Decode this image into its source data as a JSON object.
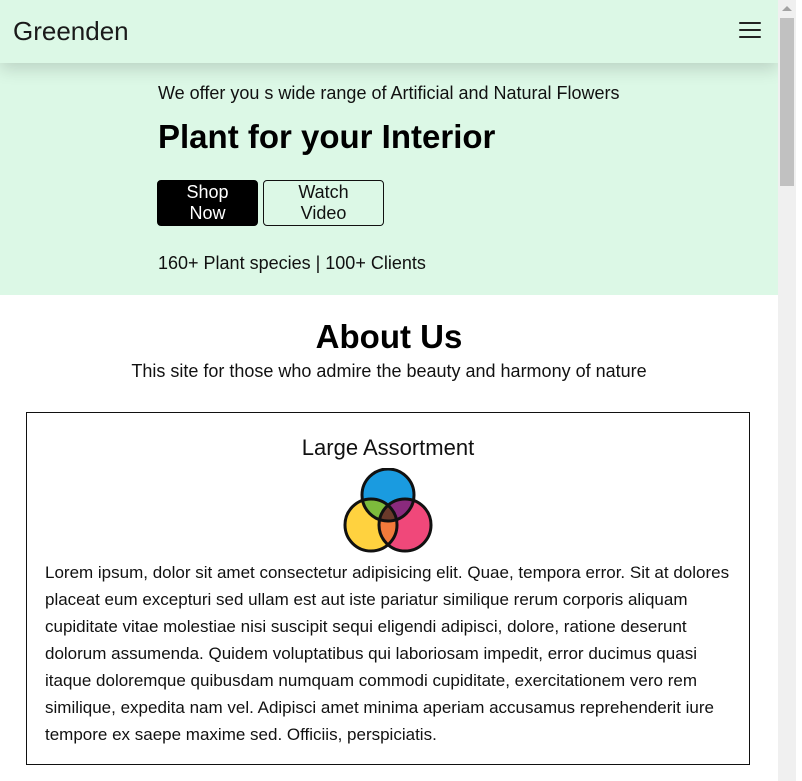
{
  "navbar": {
    "brand": "Greenden",
    "menu_icon": "hamburger-menu-icon"
  },
  "hero": {
    "subtitle": "We offer you s wide range of Artificial and Natural Flowers",
    "title": "Plant for your Interior",
    "shop_button": "Shop Now",
    "watch_button": "Watch Video",
    "stats": "160+ Plant species | 100+ Clients"
  },
  "about": {
    "title": "About Us",
    "subtitle": "This site for those who admire the beauty and harmony of nature",
    "card": {
      "title": "Large Assortment",
      "icon": "venn-circles-icon",
      "text": "Lorem ipsum, dolor sit amet consectetur adipisicing elit. Quae, tempora error. Sit at dolores placeat eum excepturi sed ullam est aut iste pariatur similique rerum corporis aliquam cupiditate vitae molestiae nisi suscipit sequi eligendi adipisci, dolore, ratione deserunt dolorum assumenda. Quidem voluptatibus qui laboriosam impedit, error ducimus quasi itaque doloremque quibusdam numquam commodi cupiditate, exercitationem vero rem similique, expedita nam vel. Adipisci amet minima aperiam accusamus reprehenderit iure tempore ex saepe maxime sed. Officiis, perspiciatis."
    }
  },
  "colors": {
    "hero_background": "#dcf8e6",
    "primary_button": "#000000",
    "circle_blue": "#1a9be0",
    "circle_yellow": "#ffd23f",
    "circle_pink": "#f0487a"
  }
}
